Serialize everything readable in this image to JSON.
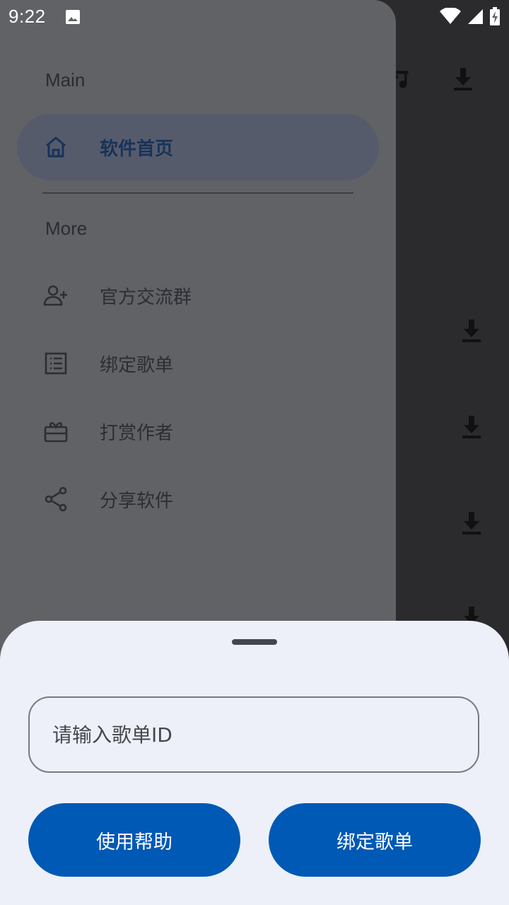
{
  "status": {
    "time": "9:22"
  },
  "drawer": {
    "section_main": "Main",
    "section_more": "More",
    "items": [
      {
        "label": "软件首页",
        "icon": "home-icon",
        "active": true
      },
      {
        "label": "官方交流群",
        "icon": "add-person-icon"
      },
      {
        "label": "绑定歌单",
        "icon": "list-icon"
      },
      {
        "label": "打赏作者",
        "icon": "gift-icon"
      },
      {
        "label": "分享软件",
        "icon": "share-icon"
      }
    ]
  },
  "sheet": {
    "input_placeholder": "请输入歌单ID",
    "help_button": "使用帮助",
    "bind_button": "绑定歌单"
  },
  "colors": {
    "accent": "#0059b5",
    "drawer_bg": "#616266",
    "sheet_bg": "#edf0f9",
    "active_item_bg": "#565b6b"
  }
}
